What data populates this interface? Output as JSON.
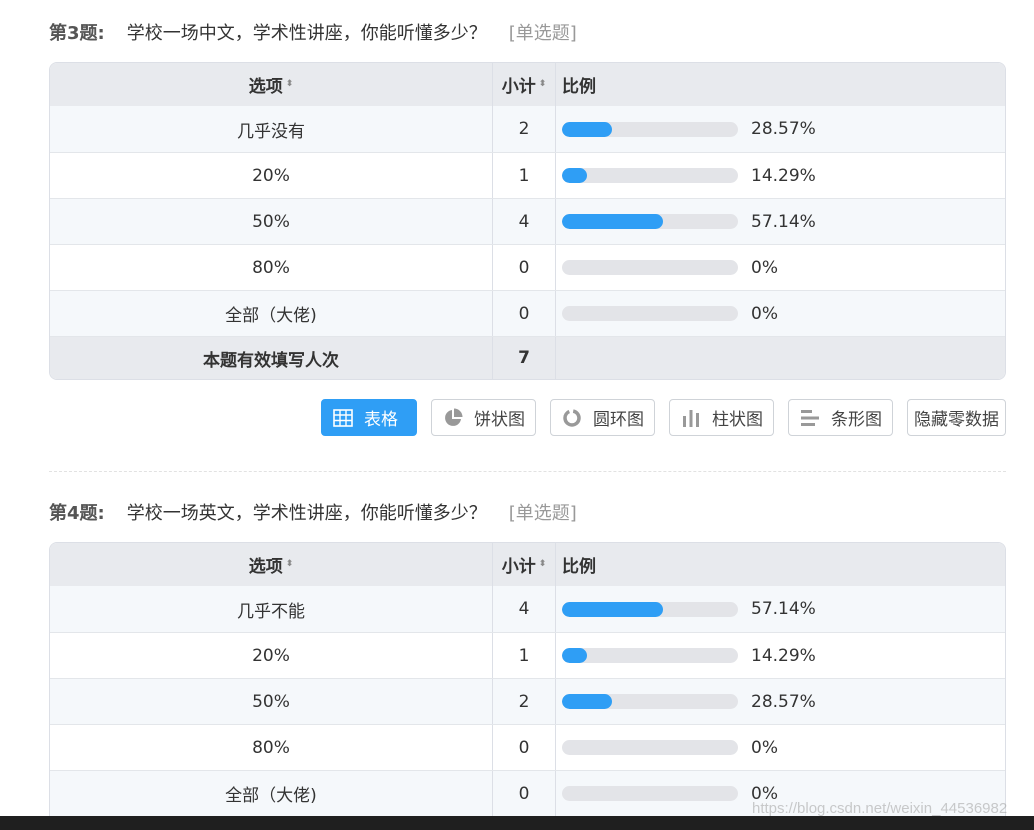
{
  "q3": {
    "num": "第3题:",
    "text": "学校一场中文，学术性讲座，你能听懂多少？",
    "type": "[单选题]",
    "headers": {
      "option": "选项",
      "count": "小计",
      "pct": "比例",
      "sort_icon": "⬍"
    },
    "rows": [
      {
        "option": "几乎没有",
        "count": "2",
        "pct": "28.57%",
        "fill": 0.2857
      },
      {
        "option": "20%",
        "count": "1",
        "pct": "14.29%",
        "fill": 0.1429
      },
      {
        "option": "50%",
        "count": "4",
        "pct": "57.14%",
        "fill": 0.5714
      },
      {
        "option": "80%",
        "count": "0",
        "pct": "0%",
        "fill": 0
      },
      {
        "option": "全部（大佬)",
        "count": "0",
        "pct": "0%",
        "fill": 0
      }
    ],
    "total_label": "本题有效填写人次",
    "total": "7"
  },
  "toolbar": {
    "table": "表格",
    "pie": "饼状图",
    "donut": "圆环图",
    "column": "柱状图",
    "bar": "条形图",
    "hide_zero": "隐藏零数据"
  },
  "q4": {
    "num": "第4题:",
    "text": "学校一场英文，学术性讲座，你能听懂多少？",
    "type": "[单选题]",
    "headers": {
      "option": "选项",
      "count": "小计",
      "pct": "比例",
      "sort_icon": "⬍"
    },
    "rows": [
      {
        "option": "几乎不能",
        "count": "4",
        "pct": "57.14%",
        "fill": 0.5714
      },
      {
        "option": "20%",
        "count": "1",
        "pct": "14.29%",
        "fill": 0.1429
      },
      {
        "option": "50%",
        "count": "2",
        "pct": "28.57%",
        "fill": 0.2857
      },
      {
        "option": "80%",
        "count": "0",
        "pct": "0%",
        "fill": 0
      },
      {
        "option": "全部（大佬)",
        "count": "0",
        "pct": "0%",
        "fill": 0
      }
    ]
  },
  "watermark": "https://blog.csdn.net/weixin_44536982",
  "colors": {
    "accent": "#2f9ef5",
    "bar_track": "#e3e4e8"
  }
}
